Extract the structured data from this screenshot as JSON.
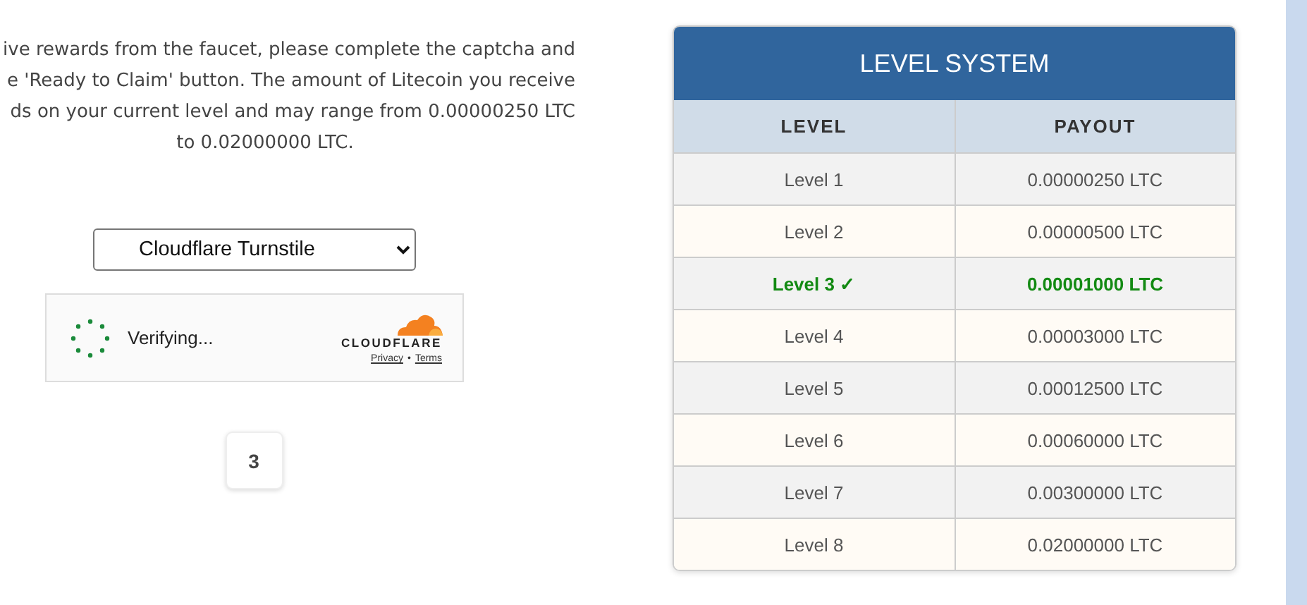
{
  "intro_lines": [
    "ive rewards from the faucet, please complete the captcha and",
    "e 'Ready to Claim' button. The amount of Litecoin you receive",
    "ds on your current level and may range from 0.00000250 LTC",
    "to 0.02000000 LTC."
  ],
  "captcha_select": {
    "value": "Cloudflare Turnstile"
  },
  "captcha": {
    "status": "Verifying...",
    "brand": "CLOUDFLARE",
    "links": [
      "Privacy",
      "Terms"
    ],
    "separator": "•"
  },
  "countdown": "3",
  "level_table": {
    "title": "LEVEL SYSTEM",
    "columns": [
      "LEVEL",
      "PAYOUT"
    ],
    "rows": [
      {
        "level": "Level 1",
        "payout": "0.00000250 LTC",
        "selected": false
      },
      {
        "level": "Level 2",
        "payout": "0.00000500 LTC",
        "selected": false
      },
      {
        "level": "Level 3 ✓",
        "payout": "0.00001000 LTC",
        "selected": true
      },
      {
        "level": "Level 4",
        "payout": "0.00003000 LTC",
        "selected": false
      },
      {
        "level": "Level 5",
        "payout": "0.00012500 LTC",
        "selected": false
      },
      {
        "level": "Level 6",
        "payout": "0.00060000 LTC",
        "selected": false
      },
      {
        "level": "Level 7",
        "payout": "0.00300000 LTC",
        "selected": false
      },
      {
        "level": "Level 8",
        "payout": "0.02000000 LTC",
        "selected": false
      }
    ]
  }
}
